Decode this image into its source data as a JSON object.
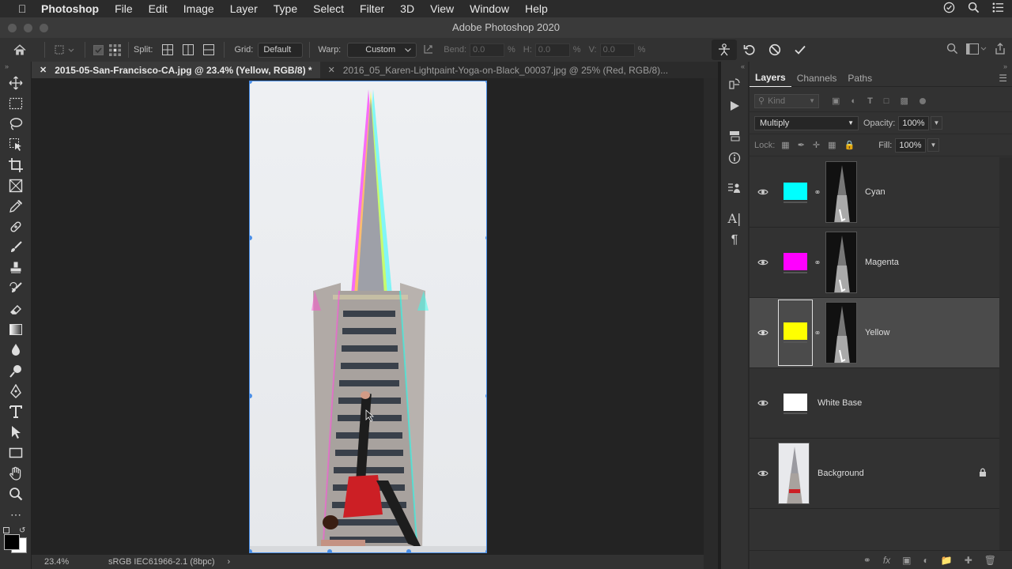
{
  "menubar": {
    "app": "Photoshop",
    "items": [
      "File",
      "Edit",
      "Image",
      "Layer",
      "Type",
      "Select",
      "Filter",
      "3D",
      "View",
      "Window",
      "Help"
    ]
  },
  "window_title": "Adobe Photoshop 2020",
  "options_bar": {
    "split_label": "Split:",
    "grid_label": "Grid:",
    "grid_value": "Default",
    "warp_label": "Warp:",
    "warp_value": "Custom",
    "bend_label": "Bend:",
    "bend_value": "0.0",
    "bend_unit": "%",
    "h_label": "H:",
    "h_value": "0.0",
    "h_unit": "%",
    "v_label": "V:",
    "v_value": "0.0",
    "v_unit": "%"
  },
  "tabs": [
    {
      "label": "2015-05-San-Francisco-CA.jpg @ 23.4% (Yellow, RGB/8) *",
      "active": true
    },
    {
      "label": "2016_05_Karen-Lightpaint-Yoga-on-Black_00037.jpg @ 25% (Red, RGB/8)...",
      "active": false
    }
  ],
  "status": {
    "zoom": "23.4%",
    "profile": "sRGB IEC61966-2.1 (8bpc)"
  },
  "layers_panel": {
    "tabs": [
      "Layers",
      "Channels",
      "Paths"
    ],
    "filter_placeholder": "Kind",
    "blend_mode": "Multiply",
    "opacity_label": "Opacity:",
    "opacity_value": "100%",
    "lock_label": "Lock:",
    "fill_label": "Fill:",
    "fill_value": "100%",
    "layers": [
      {
        "name": "Cyan",
        "color": "#00ffff",
        "selected": false
      },
      {
        "name": "Magenta",
        "color": "#ff00ff",
        "selected": false
      },
      {
        "name": "Yellow",
        "color": "#ffff00",
        "selected": true
      },
      {
        "name": "White Base",
        "color": "#ffffff",
        "selected": false
      },
      {
        "name": "Background",
        "color": "",
        "selected": false,
        "locked": true
      }
    ]
  }
}
